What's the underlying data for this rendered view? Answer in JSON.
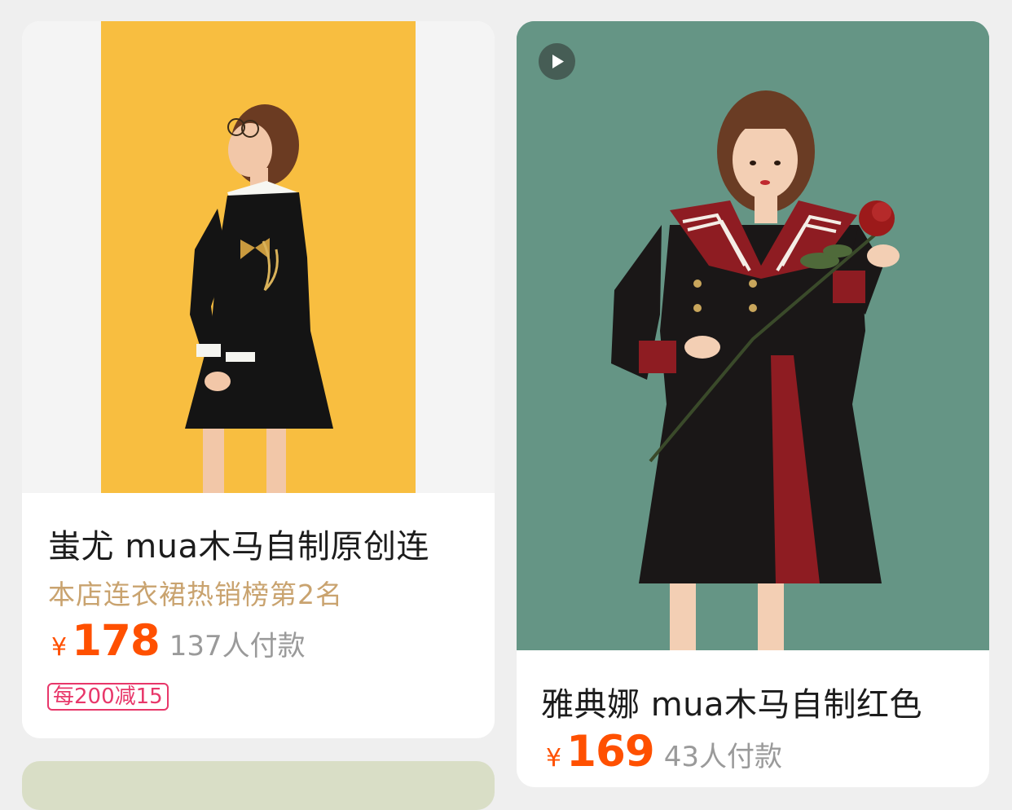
{
  "products": [
    {
      "title": "蚩尤 mua木马自制原创连",
      "rank_text": "本店连衣裙热销榜第2名",
      "currency": "¥",
      "price": "178",
      "sales": "137人付款",
      "coupon": "每200减15",
      "image": "product-photo-yellow-backdrop",
      "has_video": false
    },
    {
      "title": "雅典娜 mua木马自制红色",
      "currency": "¥",
      "price": "169",
      "sales": "43人付款",
      "image": "product-photo-green-backdrop",
      "has_video": true,
      "video_icon": "play-icon"
    }
  ],
  "colors": {
    "price": "#ff5000",
    "sales": "#9a9a9a",
    "rank": "#c9a36f",
    "coupon": "#e8376a",
    "page_bg": "#efefef",
    "card_bg": "#ffffff"
  }
}
